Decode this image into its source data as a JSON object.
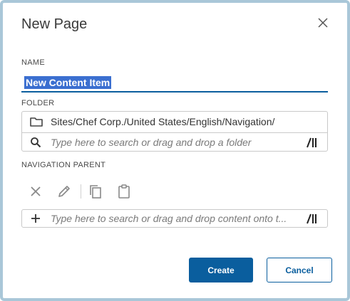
{
  "dialog": {
    "title": "New Page"
  },
  "name": {
    "label": "NAME",
    "value": "New Content Item"
  },
  "folder": {
    "label": "FOLDER",
    "path": "Sites/Chef Corp./United States/English/Navigation/",
    "search_placeholder": "Type here to search or drag and drop a folder"
  },
  "navigation_parent": {
    "label": "NAVIGATION PARENT",
    "tools": [
      "close-icon",
      "pencil-icon",
      "copy-icon",
      "clipboard-icon"
    ],
    "search_placeholder": "Type here to search or drag and drop content onto t..."
  },
  "buttons": {
    "create": "Create",
    "cancel": "Cancel"
  },
  "colors": {
    "primary": "#0a5e9e",
    "selection": "#3b6fd0",
    "frame": "#a9c7d8"
  }
}
